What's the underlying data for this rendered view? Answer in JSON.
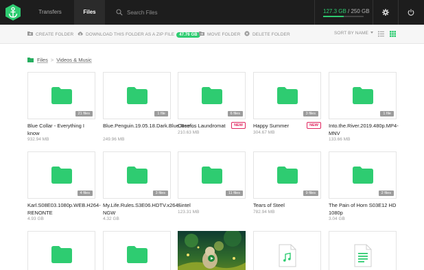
{
  "app": {
    "nav": {
      "transfers": "Transfers",
      "files": "Files"
    },
    "search": {
      "placeholder": "Search Files"
    },
    "storage": {
      "used": "127.3 GB",
      "separator": " / ",
      "total": "250 GB",
      "used_fraction": 0.51
    }
  },
  "toolbar": {
    "create_folder": "CREATE FOLDER",
    "download_zip": "DOWNLOAD THIS FOLDER AS A ZIP FILE",
    "zip_size": "47.76 GB",
    "move_folder": "MOVE FOLDER",
    "delete_folder": "DELETE FOLDER",
    "sort": "SORT BY NAME"
  },
  "breadcrumb": {
    "root": "Files",
    "separator": ">",
    "current": "Videos & Music"
  },
  "colors": {
    "accent": "#2ecc71",
    "new_badge": "#e0245e",
    "topbar": "#1d1d1d"
  },
  "tiles": [
    {
      "name": "Blue Collar - Everything I know",
      "size": "932.94 MB",
      "count": "21 files",
      "new": ""
    },
    {
      "name": "Blue.Penguin.19.05.18.Dark.Blue.Reef...",
      "size": "249.96 MB",
      "count": "1 file",
      "new": ""
    },
    {
      "name": "Cosmos Laundromat",
      "size": "210.63 MB",
      "count": "6 files",
      "new": "NEW"
    },
    {
      "name": "Happy Summer",
      "size": "304.67 MB",
      "count": "3 files",
      "new": "NEW"
    },
    {
      "name": "Into.the.River.2019.480p.MP4-MNV",
      "size": "133.66 MB",
      "count": "1 file",
      "new": ""
    },
    {
      "name": "Karl.S08E03.1080p.WEB.H264-RENONTE",
      "size": "4.93 GB",
      "count": "4 files",
      "new": ""
    },
    {
      "name": "My.Life.Rules.S3E06.HDTV.x264-NGW",
      "size": "4.32 GB",
      "count": "3 files",
      "new": ""
    },
    {
      "name": "Sintel",
      "size": "123.31 MB",
      "count": "11 files",
      "new": ""
    },
    {
      "name": "Tears of Steel",
      "size": "782.94 MB",
      "count": "9 files",
      "new": ""
    },
    {
      "name": "The Pain of Horn S03E12 HD 1080p",
      "size": "3.04 GB",
      "count": "2 files",
      "new": ""
    }
  ],
  "bottom_tiles": [
    {
      "kind": "folder",
      "icon": "folder-icon"
    },
    {
      "kind": "folder",
      "icon": "folder-icon"
    },
    {
      "kind": "video",
      "icon": "video-thumbnail"
    },
    {
      "kind": "audio",
      "icon": "music-file-icon"
    },
    {
      "kind": "document",
      "icon": "document-file-icon"
    }
  ]
}
